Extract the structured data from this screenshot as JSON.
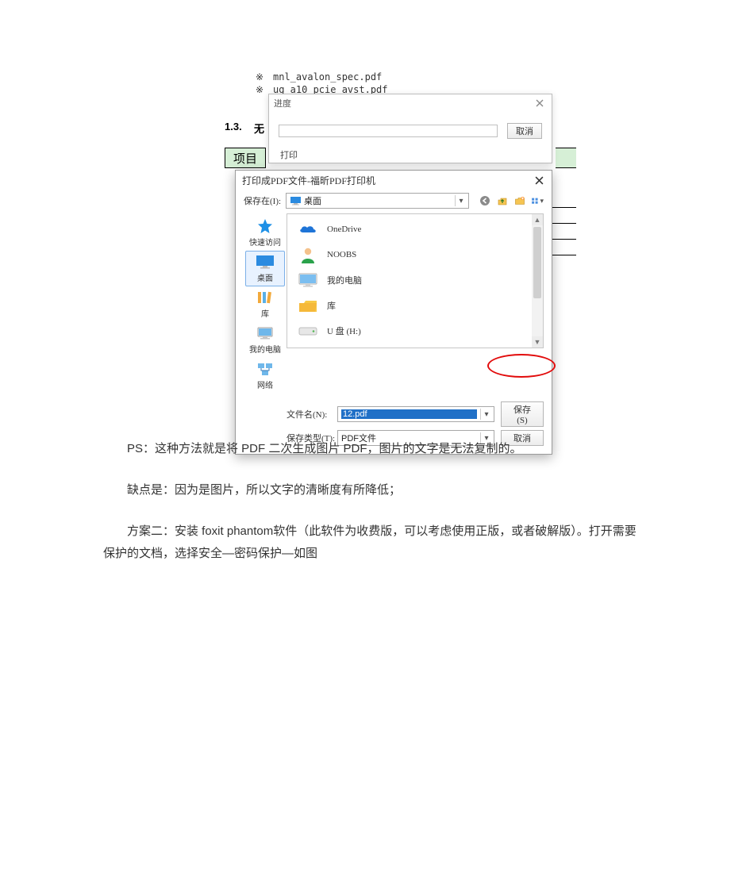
{
  "background": {
    "line1": "mnl_avalon_spec.pdf",
    "line2": "ug a10 pcie avst.pdf",
    "section_number": "1.3.",
    "section_title_fragment": "无",
    "green_label": "项目",
    "progress_label": "打印"
  },
  "progress_dialog": {
    "title": "进度",
    "cancel": "取消"
  },
  "save_dialog": {
    "title": "打印成PDF文件-福昕PDF打印机",
    "location_label": "保存在(I):",
    "location_value": "桌面",
    "toolbar_icons": {
      "back": "back-icon",
      "up": "up-one-level-icon",
      "new_folder": "new-folder-icon",
      "views": "views-icon"
    },
    "places": [
      {
        "id": "quick",
        "label": "快速访问"
      },
      {
        "id": "desktop",
        "label": "桌面"
      },
      {
        "id": "libraries",
        "label": "库"
      },
      {
        "id": "thispc",
        "label": "我的电脑"
      },
      {
        "id": "network",
        "label": "网络"
      }
    ],
    "items": [
      {
        "icon": "onedrive",
        "label": "OneDrive"
      },
      {
        "icon": "user",
        "label": "NOOBS"
      },
      {
        "icon": "pc",
        "label": "我的电脑"
      },
      {
        "icon": "folder",
        "label": "库"
      },
      {
        "icon": "drive",
        "label": "U 盘 (H:)"
      }
    ],
    "filename_label": "文件名(N):",
    "filename_value": "12.pdf",
    "filetype_label": "保存类型(T):",
    "filetype_value": "PDF文件",
    "save_button": "保存(S)",
    "cancel_button": "取消"
  },
  "paragraphs": {
    "p1": "PS：这种方法就是将 PDF 二次生成图片 PDF，图片的文字是无法复制的。",
    "p2": "缺点是：因为是图片，所以文字的清晰度有所降低；",
    "p3": "方案二：安装 foxit phantom软件（此软件为收费版，可以考虑使用正版，或者破解版）。打开需要保护的文档，选择安全—密码保护—如图"
  }
}
